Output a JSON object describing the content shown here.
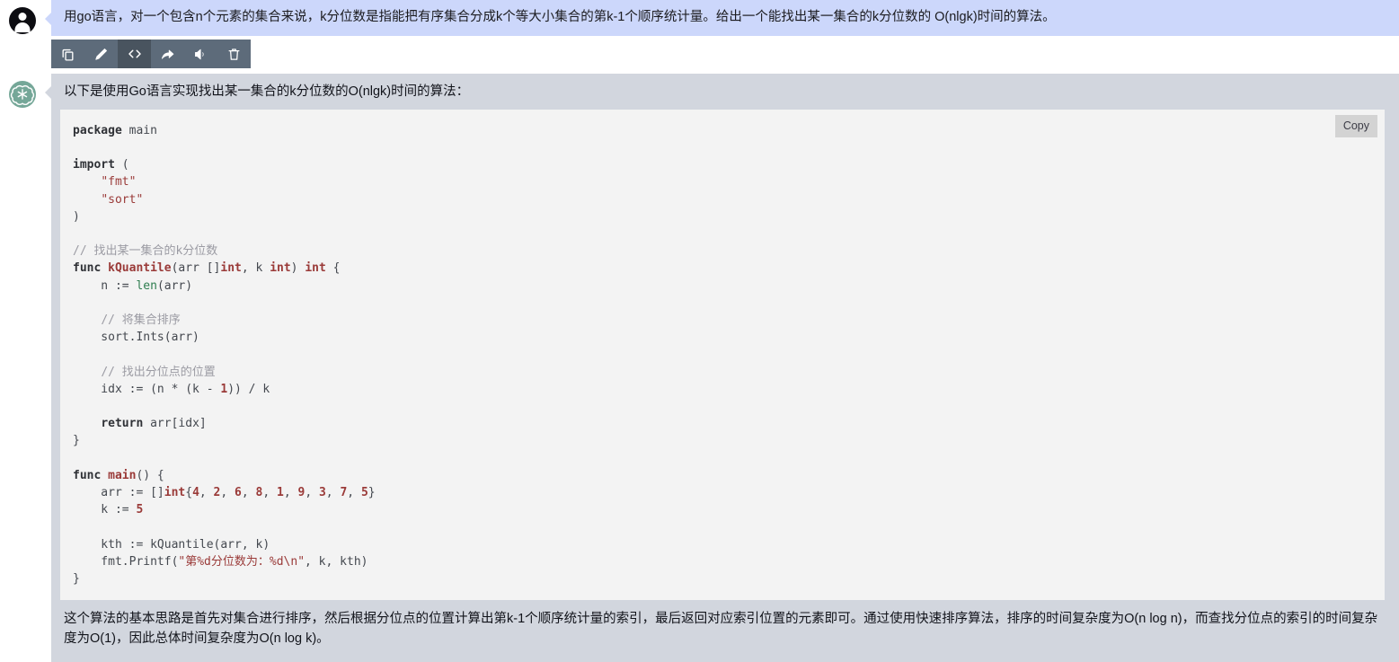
{
  "conversation": {
    "user_message": {
      "avatar_icon": "user-avatar-icon",
      "text": "用go语言，对一个包含n个元素的集合来说，k分位数是指能把有序集合分成k个等大小集合的第k-1个顺序统计量。给出一个能找出某一集合的k分位数的 O(nlgk)时间的算法。",
      "bubble_color": "#ccd7fb"
    },
    "toolbar": {
      "buttons": [
        {
          "name": "copy-button",
          "icon": "copy-icon",
          "active": false
        },
        {
          "name": "edit-button",
          "icon": "pencil-icon",
          "active": false
        },
        {
          "name": "code-button",
          "icon": "code-icon",
          "active": true
        },
        {
          "name": "share-button",
          "icon": "share-icon",
          "active": false
        },
        {
          "name": "speak-button",
          "icon": "speaker-icon",
          "active": false
        },
        {
          "name": "delete-button",
          "icon": "trash-icon",
          "active": false
        }
      ],
      "background_color": "#5d6b7a",
      "active_color": "#49545f"
    },
    "assistant_message": {
      "avatar_icon": "chatgpt-logo-icon",
      "bubble_color": "#d2d6de",
      "lead_text": "以下是使用Go语言实现找出某一集合的k分位数的O(nlgk)时间的算法：",
      "closing_text": "这个算法的基本思路是首先对集合进行排序，然后根据分位点的位置计算出第k-1个顺序统计量的索引，最后返回对应索引位置的元素即可。通过使用快速排序算法，排序的时间复杂度为O(n log n)，而查找分位点的索引的时间复杂度为O(1)，因此总体时间复杂度为O(n log k)。",
      "code_block": {
        "language": "go",
        "copy_label": "Copy",
        "background_color": "#f3f3f3",
        "lines": [
          [
            {
              "t": "package",
              "c": "k"
            },
            {
              "t": " main",
              "c": "pl"
            }
          ],
          [],
          [
            {
              "t": "import",
              "c": "k"
            },
            {
              "t": " (",
              "c": "pl"
            }
          ],
          [
            {
              "t": "    ",
              "c": "pl"
            },
            {
              "t": "\"fmt\"",
              "c": "st"
            }
          ],
          [
            {
              "t": "    ",
              "c": "pl"
            },
            {
              "t": "\"sort\"",
              "c": "st"
            }
          ],
          [
            {
              "t": ")",
              "c": "pl"
            }
          ],
          [],
          [
            {
              "t": "// 找出某一集合的k分位数",
              "c": "cm"
            }
          ],
          [
            {
              "t": "func ",
              "c": "k"
            },
            {
              "t": "kQuantile",
              "c": "fn"
            },
            {
              "t": "(arr []",
              "c": "pl"
            },
            {
              "t": "int",
              "c": "ty"
            },
            {
              "t": ", k ",
              "c": "pl"
            },
            {
              "t": "int",
              "c": "ty"
            },
            {
              "t": ") ",
              "c": "pl"
            },
            {
              "t": "int",
              "c": "ty"
            },
            {
              "t": " {",
              "c": "pl"
            }
          ],
          [
            {
              "t": "    n := ",
              "c": "pl"
            },
            {
              "t": "len",
              "c": "bi"
            },
            {
              "t": "(arr)",
              "c": "pl"
            }
          ],
          [],
          [
            {
              "t": "    ",
              "c": "pl"
            },
            {
              "t": "// 将集合排序",
              "c": "cm"
            }
          ],
          [
            {
              "t": "    sort.Ints(arr)",
              "c": "pl"
            }
          ],
          [],
          [
            {
              "t": "    ",
              "c": "pl"
            },
            {
              "t": "// 找出分位点的位置",
              "c": "cm"
            }
          ],
          [
            {
              "t": "    idx := (n * (k - ",
              "c": "pl"
            },
            {
              "t": "1",
              "c": "nu"
            },
            {
              "t": ")) / k",
              "c": "pl"
            }
          ],
          [],
          [
            {
              "t": "    ",
              "c": "pl"
            },
            {
              "t": "return",
              "c": "k"
            },
            {
              "t": " arr[idx]",
              "c": "pl"
            }
          ],
          [
            {
              "t": "}",
              "c": "pl"
            }
          ],
          [],
          [
            {
              "t": "func ",
              "c": "k"
            },
            {
              "t": "main",
              "c": "fn"
            },
            {
              "t": "() {",
              "c": "pl"
            }
          ],
          [
            {
              "t": "    arr := []",
              "c": "pl"
            },
            {
              "t": "int",
              "c": "ty"
            },
            {
              "t": "{",
              "c": "pl"
            },
            {
              "t": "4",
              "c": "nu"
            },
            {
              "t": ", ",
              "c": "pl"
            },
            {
              "t": "2",
              "c": "nu"
            },
            {
              "t": ", ",
              "c": "pl"
            },
            {
              "t": "6",
              "c": "nu"
            },
            {
              "t": ", ",
              "c": "pl"
            },
            {
              "t": "8",
              "c": "nu"
            },
            {
              "t": ", ",
              "c": "pl"
            },
            {
              "t": "1",
              "c": "nu"
            },
            {
              "t": ", ",
              "c": "pl"
            },
            {
              "t": "9",
              "c": "nu"
            },
            {
              "t": ", ",
              "c": "pl"
            },
            {
              "t": "3",
              "c": "nu"
            },
            {
              "t": ", ",
              "c": "pl"
            },
            {
              "t": "7",
              "c": "nu"
            },
            {
              "t": ", ",
              "c": "pl"
            },
            {
              "t": "5",
              "c": "nu"
            },
            {
              "t": "}",
              "c": "pl"
            }
          ],
          [
            {
              "t": "    k := ",
              "c": "pl"
            },
            {
              "t": "5",
              "c": "nu"
            }
          ],
          [],
          [
            {
              "t": "    kth := kQuantile(arr, k)",
              "c": "pl"
            }
          ],
          [
            {
              "t": "    fmt.Printf(",
              "c": "pl"
            },
            {
              "t": "\"第%d分位数为：%d\\n\"",
              "c": "st"
            },
            {
              "t": ", k, kth)",
              "c": "pl"
            }
          ],
          [
            {
              "t": "}",
              "c": "pl"
            }
          ]
        ]
      }
    }
  }
}
